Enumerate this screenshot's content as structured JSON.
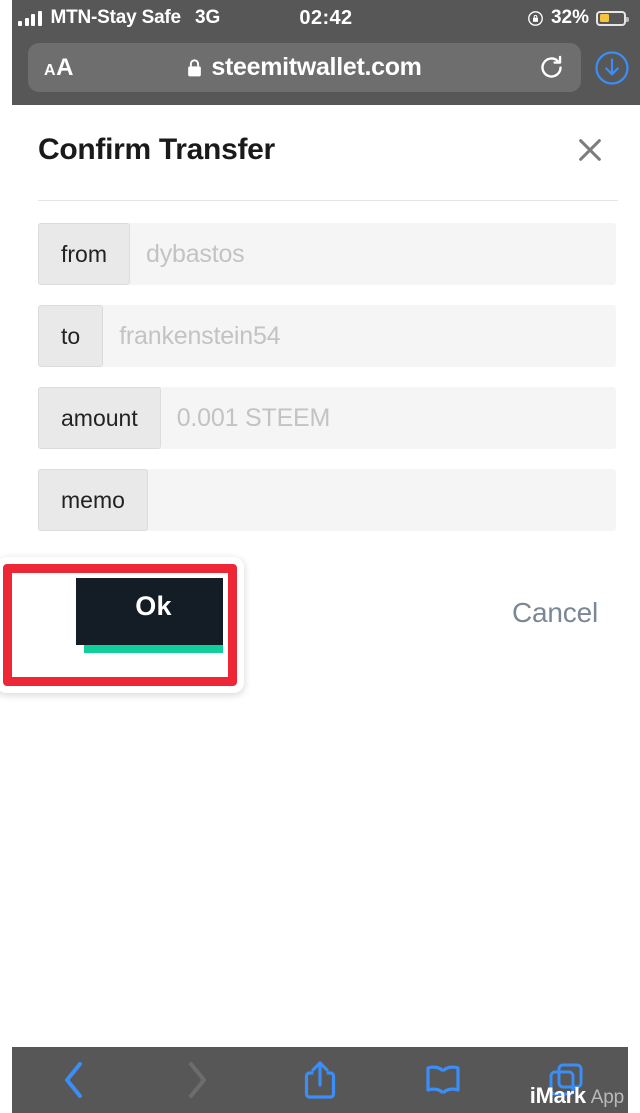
{
  "status_bar": {
    "carrier": "MTN-Stay Safe",
    "network": "3G",
    "time": "02:42",
    "battery_percent": "32%",
    "signal_icon": "signal-bars-icon",
    "rotation_lock_icon": "rotation-lock-icon",
    "battery_icon": "battery-icon",
    "battery_level": 32,
    "battery_color": "#f8c23c"
  },
  "url_bar": {
    "text_size_label_small": "A",
    "text_size_label_large": "A",
    "lock_icon": "lock-icon",
    "url": "steemitwallet.com",
    "reload_icon": "reload-icon",
    "download_icon": "download-icon"
  },
  "modal": {
    "title": "Confirm Transfer",
    "close_icon": "close-icon",
    "fields": [
      {
        "label": "from",
        "value": "dybastos"
      },
      {
        "label": "to",
        "value": "frankenstein54"
      },
      {
        "label": "amount",
        "value": "0.001 STEEM"
      },
      {
        "label": "memo",
        "value": ""
      }
    ],
    "ok_label": "Ok",
    "cancel_label": "Cancel",
    "ok_button_color": "#141c26",
    "ok_shadow_color": "#10cf9a",
    "cancel_color": "#7b8794",
    "highlight_color": "#ee2737"
  },
  "toolbar": {
    "back_icon": "chevron-left-icon",
    "forward_icon": "chevron-right-icon",
    "share_icon": "share-icon",
    "bookmarks_icon": "book-icon",
    "tabs_icon": "tabs-icon",
    "accent_color": "#3a8ef6"
  },
  "watermark": {
    "bold_text": "iMark",
    "light_text": "App"
  }
}
